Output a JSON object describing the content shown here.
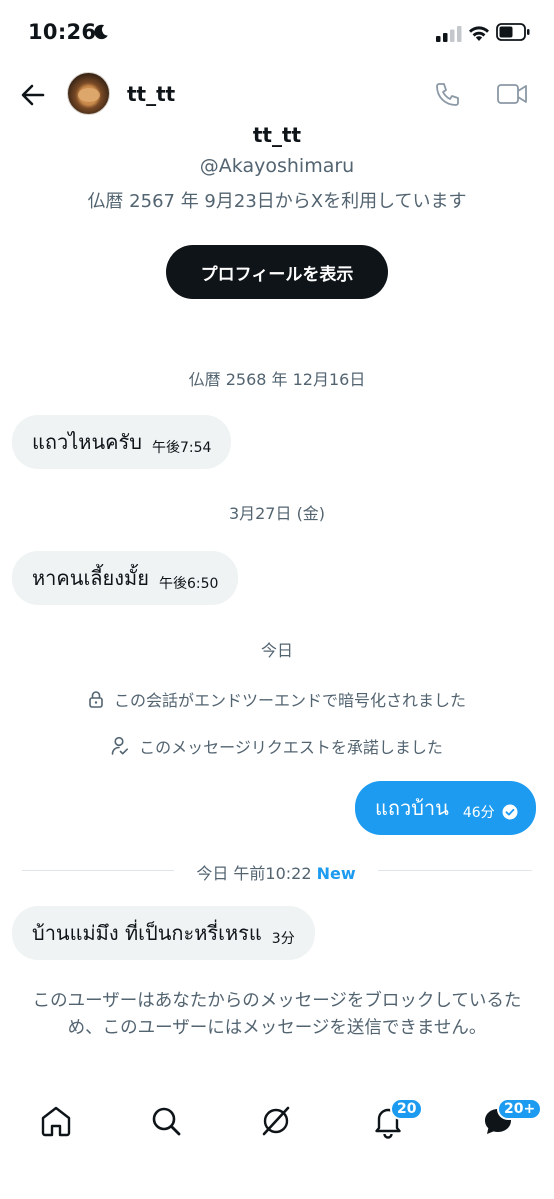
{
  "status_bar": {
    "time": "10:26"
  },
  "header": {
    "name": "tt_tt"
  },
  "profile": {
    "name": "tt_tt",
    "handle": "@Akayoshimaru",
    "joined": "仏暦 2567 年 9月23日からXを利用しています",
    "view_profile_label": "プロフィールを表示"
  },
  "conversation": {
    "date1": "仏暦 2568 年 12月16日",
    "msg1": {
      "text": "แถวไหนครับ",
      "time": "午後7:54"
    },
    "date2": "3月27日 (金)",
    "msg2": {
      "text": "หาคนเลี้ยงมั้ย",
      "time": "午後6:50"
    },
    "date3": "今日",
    "system_encrypted": "この会話がエンドツーエンドで暗号化されました",
    "system_accepted": "このメッセージリクエストを承諾しました",
    "msg3": {
      "text": "แถวบ้าน",
      "time": "46分"
    },
    "new_divider": {
      "label": "今日 午前10:22",
      "badge": "New"
    },
    "msg4": {
      "text": "บ้านแม่มึง ที่เป็นกะหรี่เหรแ",
      "time": "3分"
    },
    "blocked_notice": "このユーザーはあなたからのメッセージをブロックしているため、このユーザーにはメッセージを送信できません。"
  },
  "bottom_nav": {
    "notifications_badge": "20",
    "messages_badge": "20+"
  },
  "colors": {
    "accent": "#1d9bf0",
    "text": "#0f1419",
    "secondary": "#536471",
    "bubble_in": "#eff3f4"
  }
}
